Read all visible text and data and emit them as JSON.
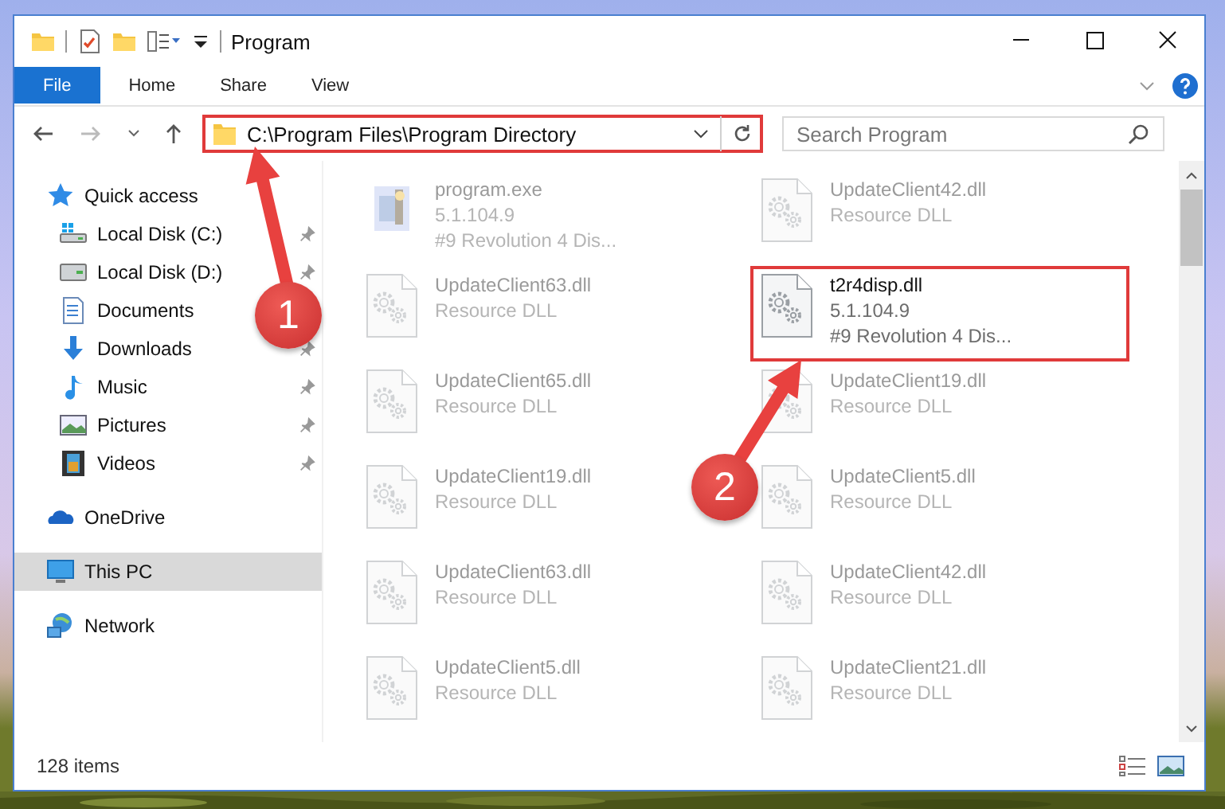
{
  "window": {
    "title": "Program"
  },
  "ribbon": {
    "tabs": [
      {
        "label": "File",
        "kind": "file"
      },
      {
        "label": "Home",
        "kind": "tab"
      },
      {
        "label": "Share",
        "kind": "tab"
      },
      {
        "label": "View",
        "kind": "tab"
      }
    ]
  },
  "address_bar": {
    "path": "C:\\Program Files\\Program Directory",
    "highlighted": true
  },
  "search": {
    "placeholder": "Search Program"
  },
  "sidebar": {
    "items": [
      {
        "label": "Quick access",
        "selected": false,
        "children": [
          {
            "label": "Local Disk (C:)",
            "selected": false,
            "pinned": true
          },
          {
            "label": "Local Disk (D:)",
            "selected": false,
            "pinned": true
          },
          {
            "label": "Documents",
            "selected": false,
            "pinned": false
          },
          {
            "label": "Downloads",
            "selected": false,
            "pinned": true
          },
          {
            "label": "Music",
            "selected": false,
            "pinned": true
          },
          {
            "label": "Pictures",
            "selected": false,
            "pinned": true
          },
          {
            "label": "Videos",
            "selected": false,
            "pinned": true
          }
        ]
      },
      {
        "label": "OneDrive",
        "selected": false
      },
      {
        "label": "This PC",
        "selected": true
      },
      {
        "label": "Network",
        "selected": false
      }
    ]
  },
  "files": [
    {
      "name": "program.exe",
      "kind": "exe",
      "details": [
        "5.1.104.9",
        "#9 Revolution 4 Dis..."
      ],
      "highlighted": false,
      "faded": true
    },
    {
      "name": "UpdateClient42.dll",
      "kind": "dll",
      "details": [
        "Resource DLL"
      ],
      "highlighted": false,
      "faded": true
    },
    {
      "name": "UpdateClient63.dll",
      "kind": "dll",
      "details": [
        "Resource DLL"
      ],
      "highlighted": false,
      "faded": true
    },
    {
      "name": "t2r4disp.dll",
      "kind": "dll",
      "details": [
        "5.1.104.9",
        "#9 Revolution 4 Dis..."
      ],
      "highlighted": true,
      "faded": false
    },
    {
      "name": "UpdateClient65.dll",
      "kind": "dll",
      "details": [
        "Resource DLL"
      ],
      "highlighted": false,
      "faded": true
    },
    {
      "name": "UpdateClient19.dll",
      "kind": "dll",
      "details": [
        "Resource DLL"
      ],
      "highlighted": false,
      "faded": true
    },
    {
      "name": "UpdateClient19.dll",
      "kind": "dll",
      "details": [
        "Resource DLL"
      ],
      "highlighted": false,
      "faded": true
    },
    {
      "name": "UpdateClient5.dll",
      "kind": "dll",
      "details": [
        "Resource DLL"
      ],
      "highlighted": false,
      "faded": true
    },
    {
      "name": "UpdateClient63.dll",
      "kind": "dll",
      "details": [
        "Resource DLL"
      ],
      "highlighted": false,
      "faded": true
    },
    {
      "name": "UpdateClient42.dll",
      "kind": "dll",
      "details": [
        "Resource DLL"
      ],
      "highlighted": false,
      "faded": true
    },
    {
      "name": "UpdateClient5.dll",
      "kind": "dll",
      "details": [
        "Resource DLL"
      ],
      "highlighted": false,
      "faded": true
    },
    {
      "name": "UpdateClient21.dll",
      "kind": "dll",
      "details": [
        "Resource DLL"
      ],
      "highlighted": false,
      "faded": true
    }
  ],
  "status_bar": {
    "item_count": "128 items"
  },
  "annotations": [
    {
      "number": "1"
    },
    {
      "number": "2"
    }
  ]
}
